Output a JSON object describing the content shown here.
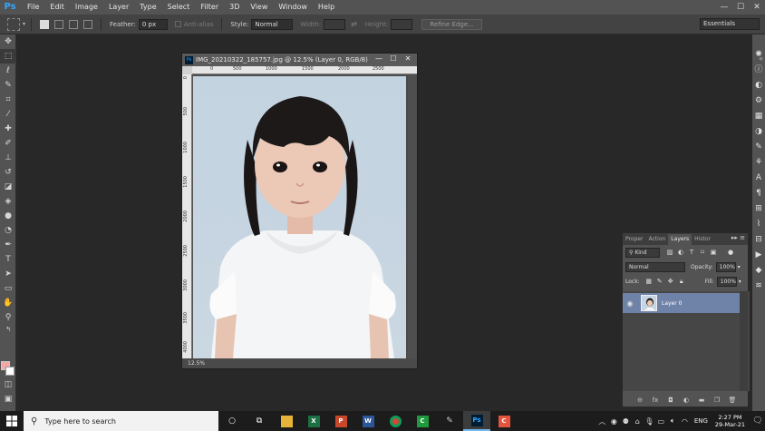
{
  "menubar": {
    "logo": "Ps",
    "items": [
      "File",
      "Edit",
      "Image",
      "Layer",
      "Type",
      "Select",
      "Filter",
      "3D",
      "View",
      "Window",
      "Help"
    ],
    "min": "—",
    "max": "☐",
    "close": "✕"
  },
  "options": {
    "feather_label": "Feather:",
    "feather_value": "0 px",
    "antialias_label": "Anti-alias",
    "style_label": "Style:",
    "style_value": "Normal",
    "width_label": "Width:",
    "height_label": "Height:",
    "refine_label": "Refine Edge...",
    "workspace": "Essentials"
  },
  "document": {
    "title": "IMG_20210322_185757.jpg @ 12.5% (Layer 0, RGB/8)",
    "zoom": "12.5%",
    "ruler_top": [
      "0",
      "500",
      "1000",
      "1500",
      "2000",
      "2500"
    ],
    "ruler_left": [
      "0",
      "500",
      "1000",
      "1500",
      "2000",
      "2500",
      "3000",
      "3500",
      "4000"
    ]
  },
  "layers_panel": {
    "tabs": [
      "Proper",
      "Action",
      "Layers",
      "Histor"
    ],
    "active_tab": "Layers",
    "kind_label": "Kind",
    "blend_mode": "Normal",
    "opacity_label": "Opacity:",
    "opacity_value": "100%",
    "lock_label": "Lock:",
    "fill_label": "Fill:",
    "fill_value": "100%",
    "layer_name": "Layer 0"
  },
  "taskbar": {
    "search_placeholder": "Type here to search",
    "language": "ENG",
    "time": "2:27 PM",
    "date": "29-Mar-21"
  },
  "colors": {
    "foreground": "#f4a7a7",
    "background": "#ffffff",
    "layer_selected": "#6f82a8"
  }
}
